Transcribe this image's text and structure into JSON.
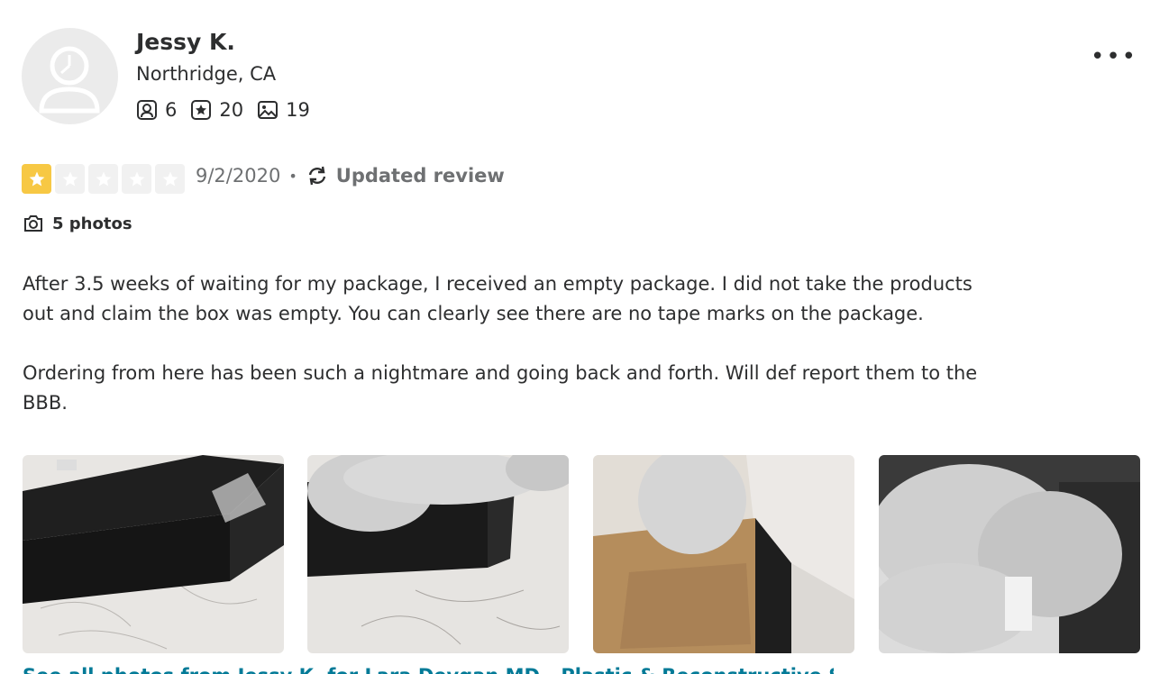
{
  "user": {
    "name": "Jessy K.",
    "location": "Northridge, CA",
    "friends_count": "6",
    "reviews_count": "20",
    "photos_count": "19"
  },
  "review": {
    "rating": 1,
    "max_rating": 5,
    "date": "9/2/2020",
    "updated_label": "Updated review",
    "photos_link": "5 photos",
    "paragraphs": [
      "After 3.5 weeks of waiting for my package, I received an empty package. I did not take the products out and claim the box was empty. You can clearly see there are no tape marks on the package.",
      "Ordering from here has been such a nightmare and going back and forth. Will def report them to the BBB."
    ],
    "caption_partial": "See all photos from Jessy K. for Lara Devgan MD - Plastic & Reconstructive Surgery"
  },
  "colors": {
    "star_on": "#f7c844",
    "star_off": "#f1f1f1",
    "link": "#027a97"
  }
}
